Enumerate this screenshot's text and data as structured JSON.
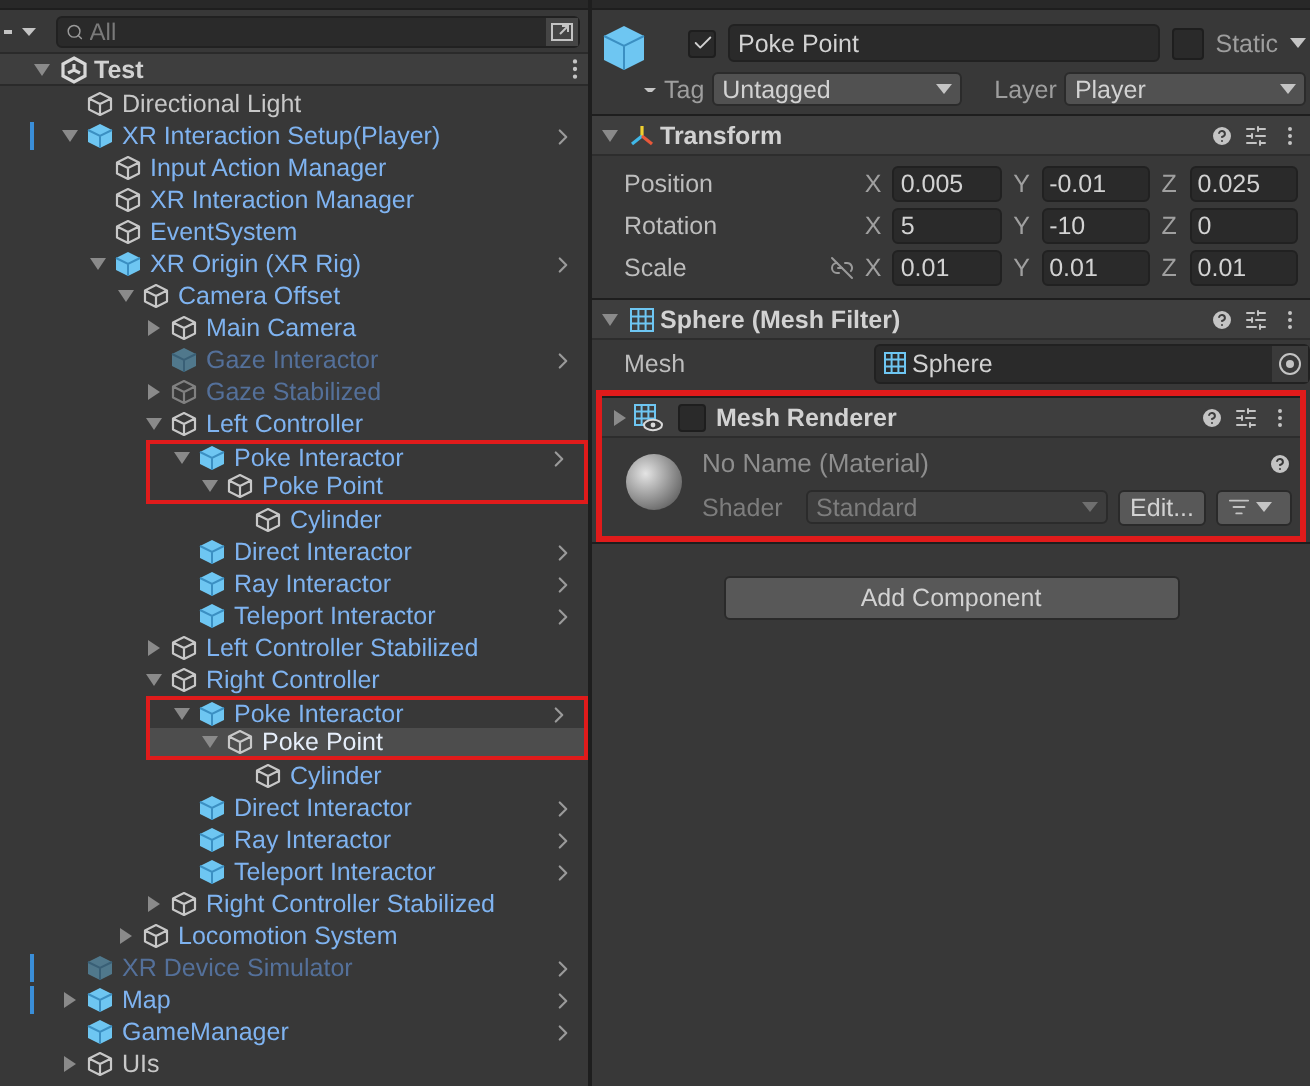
{
  "hierarchy": {
    "search": {
      "placeholder": "All"
    },
    "scene": {
      "name": "Test",
      "expanded": true
    },
    "items": [
      {
        "name": "Directional Light",
        "kind": "object",
        "prefab": false,
        "active": true,
        "chevron": false,
        "modified": false,
        "selected": false,
        "outlined": false
      },
      {
        "name": "XR Interaction Setup(Player)",
        "kind": "prefab",
        "prefab": true,
        "active": true,
        "chevron": true,
        "modified": true,
        "selected": false,
        "outlined": false,
        "expanded": true,
        "children": [
          {
            "name": "Input Action Manager",
            "kind": "object",
            "prefab": true,
            "active": true,
            "chevron": false,
            "modified": false,
            "selected": false,
            "outlined": false
          },
          {
            "name": "XR Interaction Manager",
            "kind": "object",
            "prefab": true,
            "active": true,
            "chevron": false,
            "modified": false,
            "selected": false,
            "outlined": false
          },
          {
            "name": "EventSystem",
            "kind": "object",
            "prefab": true,
            "active": true,
            "chevron": false,
            "modified": false,
            "selected": false,
            "outlined": false
          },
          {
            "name": "XR Origin (XR Rig)",
            "kind": "prefab",
            "prefab": true,
            "active": true,
            "chevron": true,
            "modified": false,
            "selected": false,
            "outlined": false,
            "expanded": true,
            "children": [
              {
                "name": "Camera Offset",
                "kind": "object",
                "prefab": true,
                "active": true,
                "chevron": false,
                "modified": false,
                "selected": false,
                "outlined": false,
                "expanded": true,
                "children": [
                  {
                    "name": "Main Camera",
                    "kind": "object",
                    "prefab": true,
                    "active": true,
                    "chevron": false,
                    "modified": false,
                    "selected": false,
                    "outlined": false,
                    "expanded": false
                  },
                  {
                    "name": "Gaze Interactor",
                    "kind": "prefab",
                    "prefab": true,
                    "active": false,
                    "chevron": true,
                    "modified": false,
                    "selected": false,
                    "outlined": false
                  },
                  {
                    "name": "Gaze Stabilized",
                    "kind": "object",
                    "prefab": true,
                    "active": false,
                    "chevron": false,
                    "modified": false,
                    "selected": false,
                    "outlined": false,
                    "expanded": false
                  },
                  {
                    "name": "Left Controller",
                    "kind": "object",
                    "prefab": true,
                    "active": true,
                    "chevron": false,
                    "modified": false,
                    "selected": false,
                    "outlined": false,
                    "expanded": true,
                    "children": [
                      {
                        "name": "Poke Interactor",
                        "kind": "prefab",
                        "prefab": true,
                        "active": true,
                        "chevron": true,
                        "modified": false,
                        "selected": false,
                        "outlined": true,
                        "expanded": true,
                        "children": [
                          {
                            "name": "Poke Point",
                            "kind": "object",
                            "prefab": true,
                            "active": true,
                            "chevron": false,
                            "modified": false,
                            "selected": false,
                            "outlined": true,
                            "expanded": true,
                            "children": [
                              {
                                "name": "Cylinder",
                                "kind": "object",
                                "prefab": true,
                                "active": true,
                                "chevron": false,
                                "modified": false,
                                "selected": false,
                                "outlined": false
                              }
                            ]
                          }
                        ]
                      },
                      {
                        "name": "Direct Interactor",
                        "kind": "prefab",
                        "prefab": true,
                        "active": true,
                        "chevron": true,
                        "modified": false,
                        "selected": false,
                        "outlined": false
                      },
                      {
                        "name": "Ray Interactor",
                        "kind": "prefab",
                        "prefab": true,
                        "active": true,
                        "chevron": true,
                        "modified": false,
                        "selected": false,
                        "outlined": false
                      },
                      {
                        "name": "Teleport Interactor",
                        "kind": "prefab",
                        "prefab": true,
                        "active": true,
                        "chevron": true,
                        "modified": false,
                        "selected": false,
                        "outlined": false
                      }
                    ]
                  },
                  {
                    "name": "Left Controller Stabilized",
                    "kind": "object",
                    "prefab": true,
                    "active": true,
                    "chevron": false,
                    "modified": false,
                    "selected": false,
                    "outlined": false,
                    "expanded": false
                  },
                  {
                    "name": "Right Controller",
                    "kind": "object",
                    "prefab": true,
                    "active": true,
                    "chevron": false,
                    "modified": false,
                    "selected": false,
                    "outlined": false,
                    "expanded": true,
                    "children": [
                      {
                        "name": "Poke Interactor",
                        "kind": "prefab",
                        "prefab": true,
                        "active": true,
                        "chevron": true,
                        "modified": false,
                        "selected": false,
                        "outlined": true,
                        "expanded": true,
                        "children": [
                          {
                            "name": "Poke Point",
                            "kind": "object",
                            "prefab": true,
                            "active": true,
                            "chevron": false,
                            "modified": false,
                            "selected": true,
                            "outlined": true,
                            "expanded": true,
                            "children": [
                              {
                                "name": "Cylinder",
                                "kind": "object",
                                "prefab": true,
                                "active": true,
                                "chevron": false,
                                "modified": false,
                                "selected": false,
                                "outlined": false
                              }
                            ]
                          }
                        ]
                      },
                      {
                        "name": "Direct Interactor",
                        "kind": "prefab",
                        "prefab": true,
                        "active": true,
                        "chevron": true,
                        "modified": false,
                        "selected": false,
                        "outlined": false
                      },
                      {
                        "name": "Ray Interactor",
                        "kind": "prefab",
                        "prefab": true,
                        "active": true,
                        "chevron": true,
                        "modified": false,
                        "selected": false,
                        "outlined": false
                      },
                      {
                        "name": "Teleport Interactor",
                        "kind": "prefab",
                        "prefab": true,
                        "active": true,
                        "chevron": true,
                        "modified": false,
                        "selected": false,
                        "outlined": false
                      }
                    ]
                  },
                  {
                    "name": "Right Controller Stabilized",
                    "kind": "object",
                    "prefab": true,
                    "active": true,
                    "chevron": false,
                    "modified": false,
                    "selected": false,
                    "outlined": false,
                    "expanded": false
                  }
                ]
              },
              {
                "name": "Locomotion System",
                "kind": "object",
                "prefab": true,
                "active": true,
                "chevron": false,
                "modified": false,
                "selected": false,
                "outlined": false,
                "expanded": false
              }
            ]
          }
        ]
      },
      {
        "name": "XR Device Simulator",
        "kind": "prefab",
        "prefab": true,
        "active": false,
        "chevron": true,
        "modified": true,
        "selected": false,
        "outlined": false
      },
      {
        "name": "Map",
        "kind": "prefab",
        "prefab": true,
        "active": true,
        "chevron": true,
        "modified": true,
        "selected": false,
        "outlined": false,
        "expanded": false
      },
      {
        "name": "GameManager",
        "kind": "prefab",
        "prefab": true,
        "active": true,
        "chevron": true,
        "modified": false,
        "selected": false,
        "outlined": false
      },
      {
        "name": "UIs",
        "kind": "object",
        "prefab": false,
        "active": true,
        "chevron": false,
        "modified": false,
        "selected": false,
        "outlined": false,
        "expanded": false
      }
    ]
  },
  "inspector": {
    "object": {
      "active": true,
      "name": "Poke Point",
      "static": false,
      "static_label": "Static",
      "tag_label": "Tag",
      "tag": "Untagged",
      "layer_label": "Layer",
      "layer": "Player"
    },
    "components": [
      {
        "kind": "transform",
        "title": "Transform",
        "expanded": true,
        "outlined": false,
        "rows": [
          {
            "label": "Position",
            "constrain_icon": false,
            "fields": [
              {
                "axis": "X",
                "value": "0.005"
              },
              {
                "axis": "Y",
                "value": "-0.01"
              },
              {
                "axis": "Z",
                "value": "0.025"
              }
            ]
          },
          {
            "label": "Rotation",
            "constrain_icon": false,
            "fields": [
              {
                "axis": "X",
                "value": "5"
              },
              {
                "axis": "Y",
                "value": "-10"
              },
              {
                "axis": "Z",
                "value": "0"
              }
            ]
          },
          {
            "label": "Scale",
            "constrain_icon": true,
            "fields": [
              {
                "axis": "X",
                "value": "0.01"
              },
              {
                "axis": "Y",
                "value": "0.01"
              },
              {
                "axis": "Z",
                "value": "0.01"
              }
            ]
          }
        ]
      },
      {
        "kind": "mesh_filter",
        "title": "Sphere (Mesh Filter)",
        "expanded": true,
        "outlined": false,
        "field_label": "Mesh",
        "value": "Sphere"
      },
      {
        "kind": "mesh_renderer",
        "title": "Mesh Renderer",
        "expanded": false,
        "enabled": false,
        "outlined": true,
        "material": {
          "name": "No Name (Material)",
          "shader_label": "Shader",
          "shader": "Standard",
          "edit": "Edit..."
        }
      }
    ],
    "add_component": "Add Component"
  }
}
